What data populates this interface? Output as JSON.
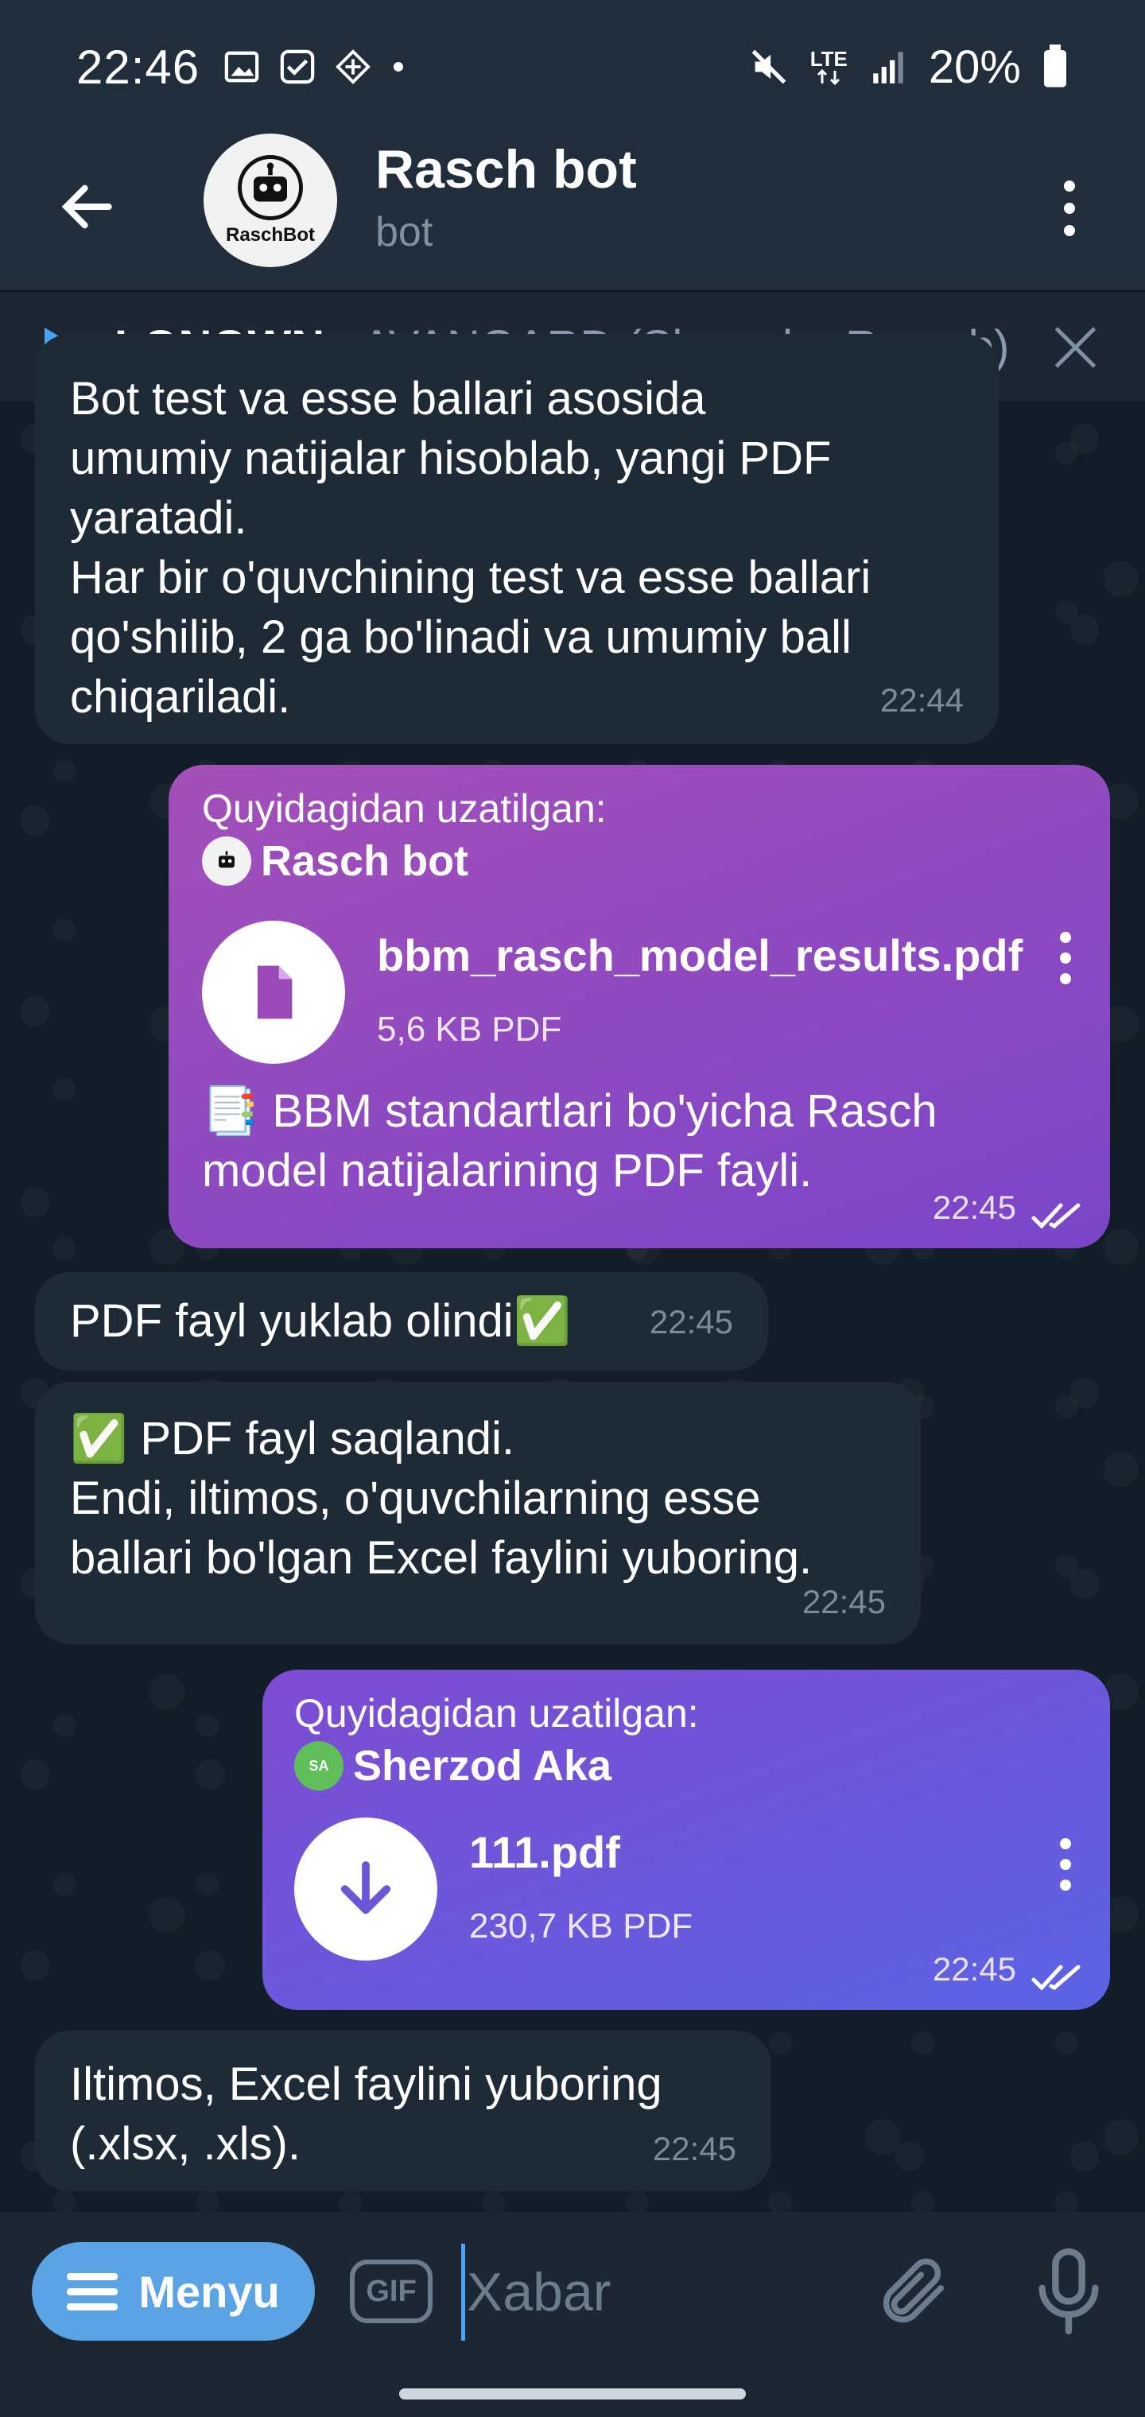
{
  "status_bar": {
    "time": "22:46",
    "battery": "20%",
    "network": "LTE",
    "icons": [
      "gallery-icon",
      "checkbox-icon",
      "vpn-icon",
      "dot-icon",
      "mute-icon",
      "lte-icon",
      "signal-icon",
      "battery-icon"
    ]
  },
  "header": {
    "back_icon": "arrow-left-icon",
    "title": "Rasch bot",
    "subtitle": "bot",
    "avatar_label": "RaschBot",
    "more_icon": "more-vertical-icon"
  },
  "music": {
    "artist": "LONOWN",
    "title": "- AVANGARD (Slowed + Reverb)"
  },
  "messages": [
    {
      "type": "in",
      "text": "Bot test va esse ballari asosida\numumiy natijalar hisoblab, yangi PDF\nyaratadi.\nHar bir o'quvchining test va esse ballari\nqo'shilib, 2 ga bo'linadi va umumiy ball\nchiqariladi.",
      "time": "22:44"
    },
    {
      "type": "out",
      "forward_label": "Quyidagidan uzatilgan:",
      "forward_from": "Rasch bot",
      "forward_avatar": "RaschBot",
      "file_name": "bbm_rasch_model_results.pdf",
      "file_meta": "5,6 KB PDF",
      "caption": "📑 BBM standartlari bo'yicha Rasch\nmodel natijalarining PDF fayli.",
      "time": "22:45"
    },
    {
      "type": "in",
      "text": "PDF fayl yuklab olindi✅",
      "time": "22:45"
    },
    {
      "type": "in",
      "text": "✅ PDF fayl saqlandi.\nEndi, iltimos, o'quvchilarning esse\nballari bo'lgan Excel faylini yuboring.",
      "time": "22:45"
    },
    {
      "type": "out",
      "forward_label": "Quyidagidan uzatilgan:",
      "forward_from": "Sherzod Aka",
      "forward_avatar": "SA",
      "file_name": "111.pdf",
      "file_meta": "230,7 KB PDF",
      "time": "22:45"
    },
    {
      "type": "in",
      "text": "Iltimos, Excel faylini yuboring\n(.xlsx, .xls).",
      "time": "22:45"
    }
  ],
  "input_bar": {
    "menu_label": "Menyu",
    "gif_label": "GIF",
    "placeholder": "Xabar"
  },
  "colors": {
    "header_bg": "#212d3b",
    "incoming_bubble": "#1e2a36",
    "outgoing_gradient_1": [
      "#a44fb8",
      "#7a45c9"
    ],
    "outgoing_gradient_2": [
      "#7e4bd2",
      "#5b63e4"
    ],
    "accent": "#5aa3e4"
  }
}
